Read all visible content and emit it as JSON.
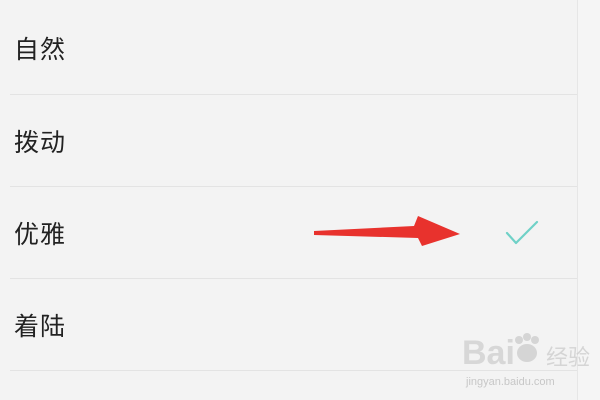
{
  "options": [
    {
      "label": "自然",
      "selected": false
    },
    {
      "label": "拨动",
      "selected": false
    },
    {
      "label": "优雅",
      "selected": true
    },
    {
      "label": "着陆",
      "selected": false
    }
  ],
  "check_icon": "checkmark-icon",
  "arrow_icon": "red-arrow-icon",
  "colors": {
    "check": "#6fd1c7",
    "arrow": "#e8322d",
    "background": "#f3f3f3"
  },
  "watermark": {
    "brand": "Bai",
    "text": "经验",
    "url": "jingyan.baidu.com"
  }
}
